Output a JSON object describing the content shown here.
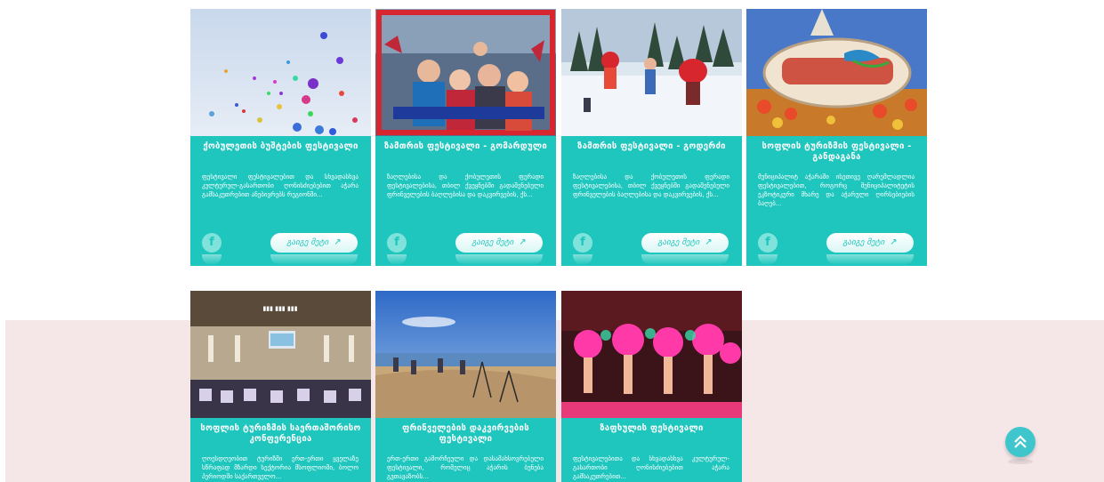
{
  "colors": {
    "card_bg": "#1ec6bd",
    "page_bg": "#ffffff",
    "band_bg": "#f5e6e8",
    "scroll_btn": "#3fc6cc"
  },
  "cards": [
    {
      "title": "ქობულეთის ბუშტების ფესტივალი",
      "desc": "ფესტივალი ფესტივალებით და სხვადასხვა კულტურულ-გასართობი ღონისძიებებით აჭარა გამსაკუთრებით ანებივრებს რეგიონში...",
      "more": "გაიგე მეტი",
      "photo": "balloons"
    },
    {
      "title": "ზამთრის ფესტივალი - გომარდული",
      "desc": "ზაღლებისა და ქობულეთის ფერადი ფესტივალებისა, თბილ ქვეყნებში გადაშენებული ფრინველების ბაღლებისა და დაკვირვების, ქს...",
      "more": "გაიგე მეტი",
      "photo": "crowd"
    },
    {
      "title": "ზამთრის ფესტივალი - გოდერძი",
      "desc": "ზაღლებისა და ქობულეთის ფერადი ფესტივალებისა, თბილ ქვეყნებში გადაშენებული ფრინველების ბაღლებისა და დაკვირვების, ქს...",
      "more": "გაიგე მეტი",
      "photo": "snow"
    },
    {
      "title": "სოფლის ტურიზმის ფესტივალი - განდაგანა",
      "desc": "მუნიციპალიტ აჭარაში ისეთივე ღარემლადლია ფესტივალებით, როგორც მუნიციპალიტეტის ეკზოტიკური მხარე და აჭარული ღირსებიების ბაღებ...",
      "more": "გაიგე მეტი",
      "photo": "sign"
    },
    {
      "title": "სოფლის ტურიზმის საერთაშორისო კონფერენცია",
      "desc": "ღოესდღეობით ტურიზმი ერთ-ერთი ყველაზე სწრაფად მზარდი სექტორია მსოფლიოში, ბოლო პერიოდში საქართველო...",
      "more": "",
      "photo": "conference"
    },
    {
      "title": "ფრინველების დაკვირვების ფესტივალი",
      "desc": "ერთ-ერთი გამორჩეული და დასამახსოვრებელი ფესტივალი, რომელიც აჭარის ბუნება გვთავაზობს...",
      "more": "",
      "photo": "birdwatch"
    },
    {
      "title": "ზაფხულის ფესტივალი",
      "desc": "ფესტივალებითა და სხვადასხვა კულტურულ-გასართობი ღონისძიებებით აჭარა გამსაკუთრებით...",
      "more": "",
      "photo": "carnival"
    }
  ],
  "fb_glyph": "f",
  "more_arrow": "↗",
  "scroll_top_icon": "chevron-double-up-icon"
}
